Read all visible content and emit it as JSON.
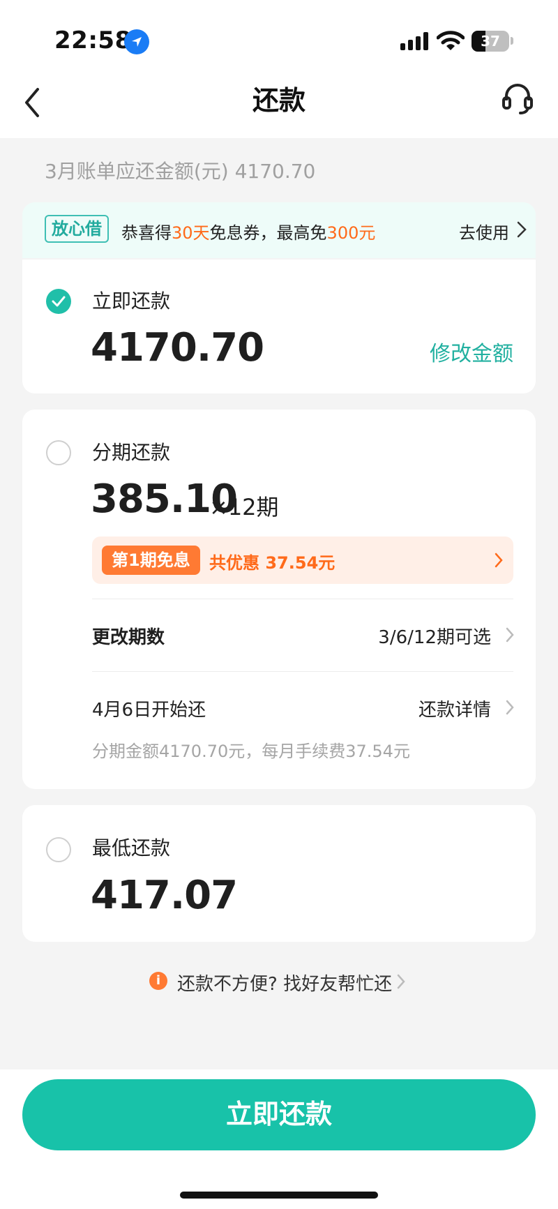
{
  "status_bar": {
    "time": "22:58",
    "battery": "37",
    "battery_level": 0.37,
    "icons": [
      "location-icon",
      "signal-icon",
      "wifi-icon",
      "battery-icon"
    ]
  },
  "nav": {
    "title": "还款",
    "back_icon": "chevron-left-icon",
    "service_icon": "headset-icon"
  },
  "bill": {
    "summary": "3月账单应还金额(元) 4170.70"
  },
  "promo": {
    "tag": "放心借",
    "text_1": "恭喜得",
    "highlight_1": "30天",
    "text_2": "免息券，最高免",
    "highlight_2": "300元",
    "action": "去使用",
    "highlight_color": "#ff6a1a"
  },
  "options": {
    "immediate": {
      "label": "立即还款",
      "amount": "4170.70",
      "modify": "修改金额",
      "selected": true
    },
    "installment": {
      "label": "分期还款",
      "amount": "385.10",
      "term": "×12期",
      "selected": false,
      "discount_tag": "第1期免息",
      "discount_text": "共优惠 37.54元",
      "change_label": "更改期数",
      "change_value": "3/6/12期可选",
      "start_label": "4月6日开始还",
      "detail_value": "还款详情",
      "note": "分期金额4170.70元，每月手续费37.54元"
    },
    "minimum": {
      "label": "最低还款",
      "amount": "417.07",
      "selected": false
    }
  },
  "help": {
    "text": "还款不方便? 找好友帮忙还"
  },
  "footer": {
    "button": "立即还款",
    "accent": "#18c2a9"
  }
}
